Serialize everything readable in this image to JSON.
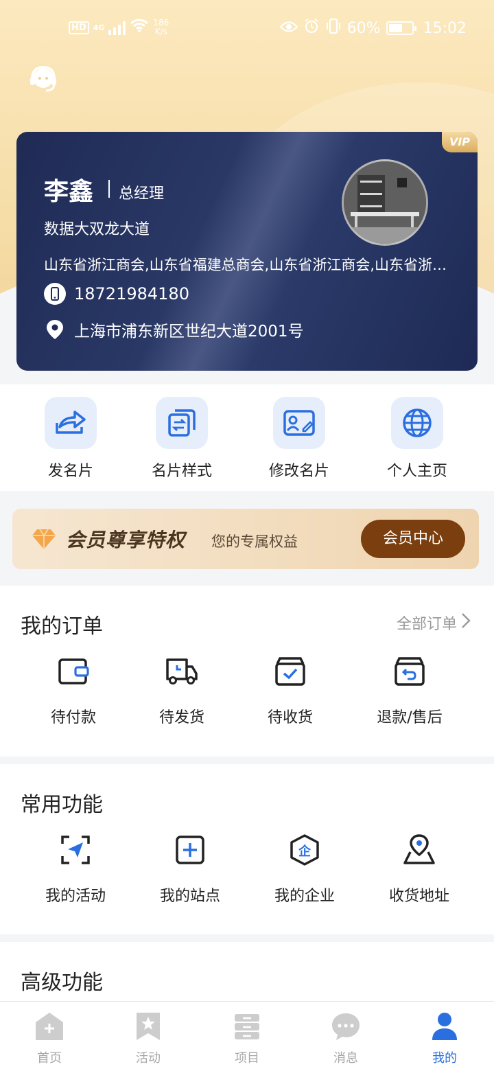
{
  "status_bar": {
    "network": "HD",
    "signal": "4G",
    "speed_value": "186",
    "speed_unit": "K/s",
    "battery": "60%",
    "time": "15:02"
  },
  "card": {
    "vip": "VIP",
    "name": "李鑫",
    "title": "总经理",
    "company": "数据大双龙大道",
    "organizations": "山东省浙江商会,山东省福建总商会,山东省浙江商会,山东省浙江商会",
    "phone": "18721984180",
    "address": "上海市浦东新区世纪大道2001号"
  },
  "quick_actions": [
    {
      "label": "发名片",
      "icon": "share-icon"
    },
    {
      "label": "名片样式",
      "icon": "card-style-icon"
    },
    {
      "label": "修改名片",
      "icon": "edit-card-icon"
    },
    {
      "label": "个人主页",
      "icon": "globe-icon"
    }
  ],
  "member": {
    "title": "会员尊享特权",
    "subtitle": "您的专属权益",
    "button": "会员中心"
  },
  "orders": {
    "title": "我的订单",
    "all": "全部订单",
    "items": [
      {
        "label": "待付款",
        "icon": "wallet-icon"
      },
      {
        "label": "待发货",
        "icon": "truck-icon"
      },
      {
        "label": "待收货",
        "icon": "box-check-icon"
      },
      {
        "label": "退款/售后",
        "icon": "refund-icon"
      }
    ]
  },
  "common": {
    "title": "常用功能",
    "items": [
      {
        "label": "我的活动",
        "icon": "activity-icon"
      },
      {
        "label": "我的站点",
        "icon": "site-icon"
      },
      {
        "label": "我的企业",
        "icon": "enterprise-icon"
      },
      {
        "label": "收货地址",
        "icon": "location-map-icon"
      }
    ]
  },
  "advanced": {
    "title": "高级功能"
  },
  "tabbar": [
    {
      "label": "首页",
      "icon": "home-icon",
      "active": false
    },
    {
      "label": "活动",
      "icon": "activity-tab-icon",
      "active": false
    },
    {
      "label": "项目",
      "icon": "project-icon",
      "active": false
    },
    {
      "label": "消息",
      "icon": "message-icon",
      "active": false
    },
    {
      "label": "我的",
      "icon": "profile-icon",
      "active": true
    }
  ],
  "colors": {
    "accent": "#2a6fe0",
    "card_bg": "#1f2b55",
    "member_button": "#7a3e0f",
    "header_gold": "#f6dda8"
  }
}
